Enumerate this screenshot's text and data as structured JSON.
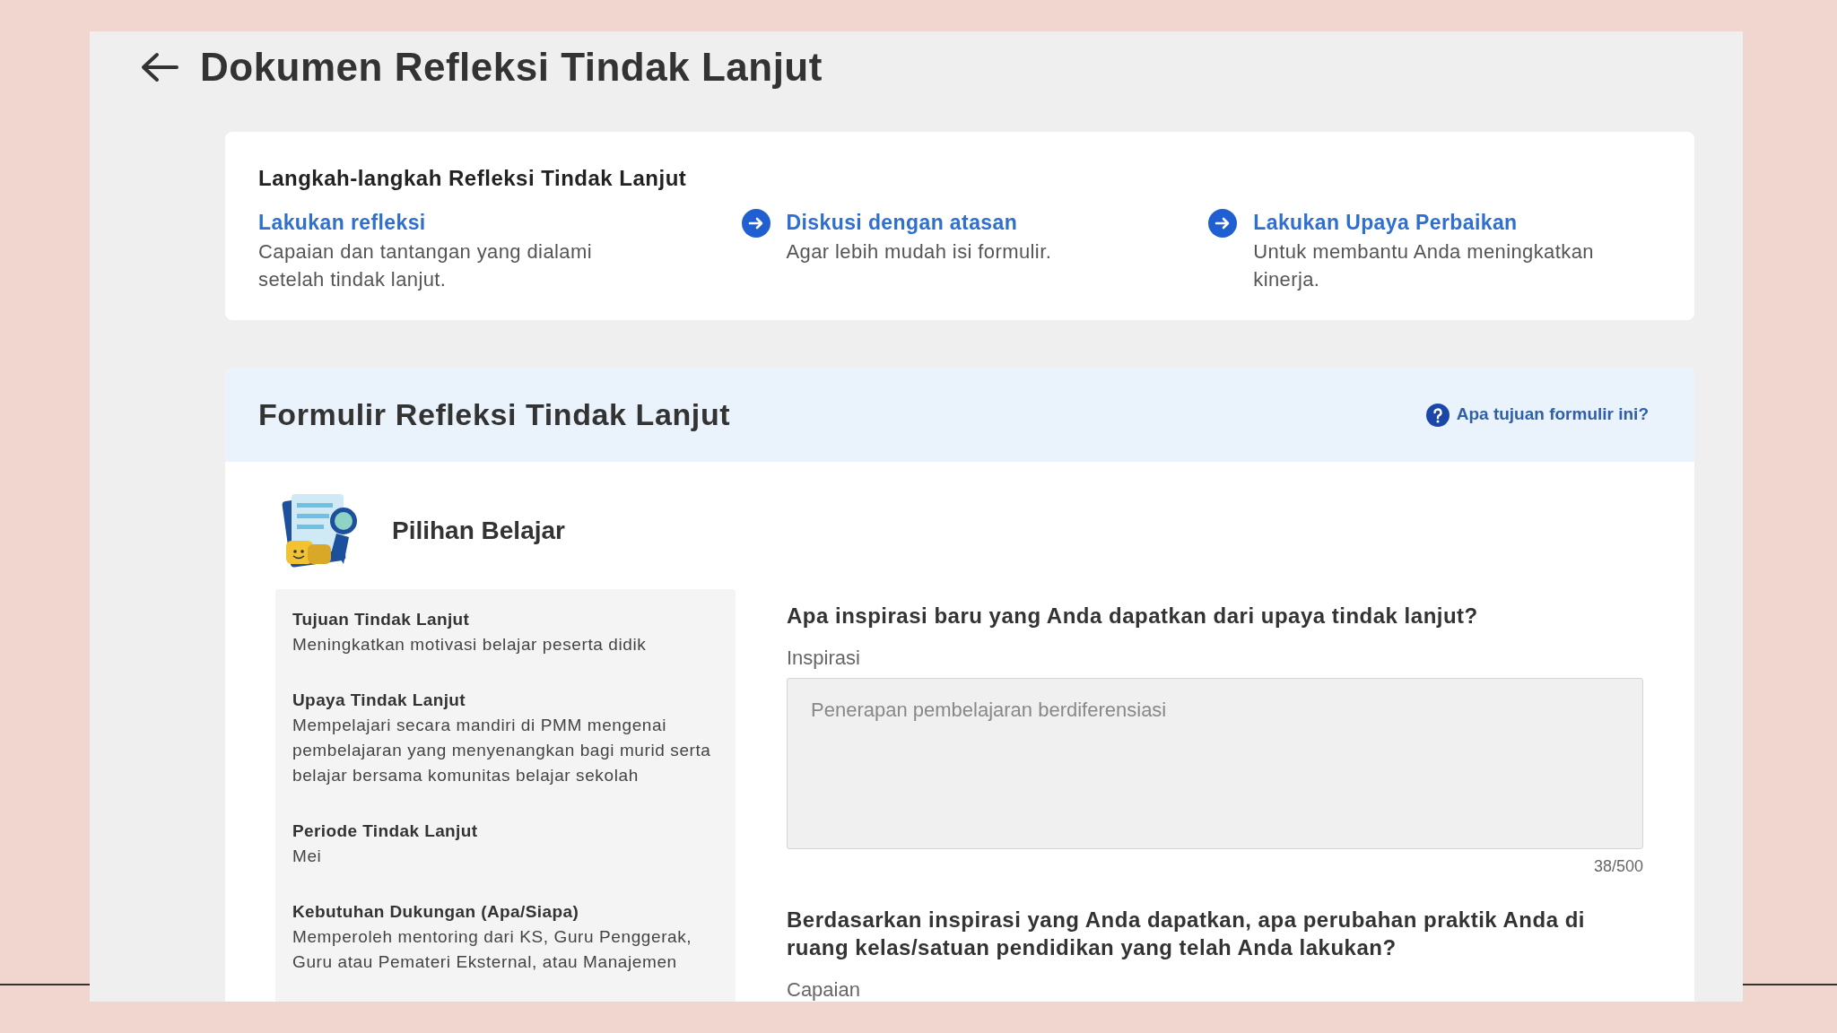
{
  "page": {
    "title": "Dokumen Refleksi Tindak Lanjut"
  },
  "steps": {
    "title": "Langkah-langkah Refleksi Tindak Lanjut",
    "items": [
      {
        "label": "Lakukan refleksi",
        "description": "Capaian dan tantangan yang dialami setelah tindak lanjut."
      },
      {
        "label": "Diskusi dengan atasan",
        "description": "Agar lebih mudah isi formulir."
      },
      {
        "label": "Lakukan Upaya Perbaikan",
        "description": "Untuk membantu Anda meningkatkan kinerja."
      }
    ]
  },
  "form": {
    "title": "Formulir Refleksi Tindak Lanjut",
    "help_link": "Apa tujuan formulir ini?",
    "section_title": "Pilihan Belajar",
    "summary": [
      {
        "label": "Tujuan Tindak Lanjut",
        "value": "Meningkatkan motivasi belajar peserta didik"
      },
      {
        "label": "Upaya Tindak Lanjut",
        "value": "Mempelajari secara mandiri di PMM mengenai pembelajaran yang menyenangkan bagi murid serta belajar bersama komunitas belajar sekolah"
      },
      {
        "label": "Periode Tindak Lanjut",
        "value": "Mei"
      },
      {
        "label": "Kebutuhan Dukungan (Apa/Siapa)",
        "value": "Memperoleh mentoring dari KS, Guru Penggerak, Guru atau Pemateri Eksternal, atau Manajemen"
      }
    ],
    "questions": [
      {
        "question": "Apa inspirasi baru yang Anda dapatkan dari upaya tindak lanjut?",
        "field_label": "Inspirasi",
        "value": "Penerapan pembelajaran berdiferensiasi",
        "counter": "38/500"
      },
      {
        "question": "Berdasarkan inspirasi yang Anda dapatkan, apa perubahan praktik Anda di ruang kelas/satuan pendidikan yang telah Anda lakukan?",
        "field_label": "Capaian"
      }
    ]
  }
}
